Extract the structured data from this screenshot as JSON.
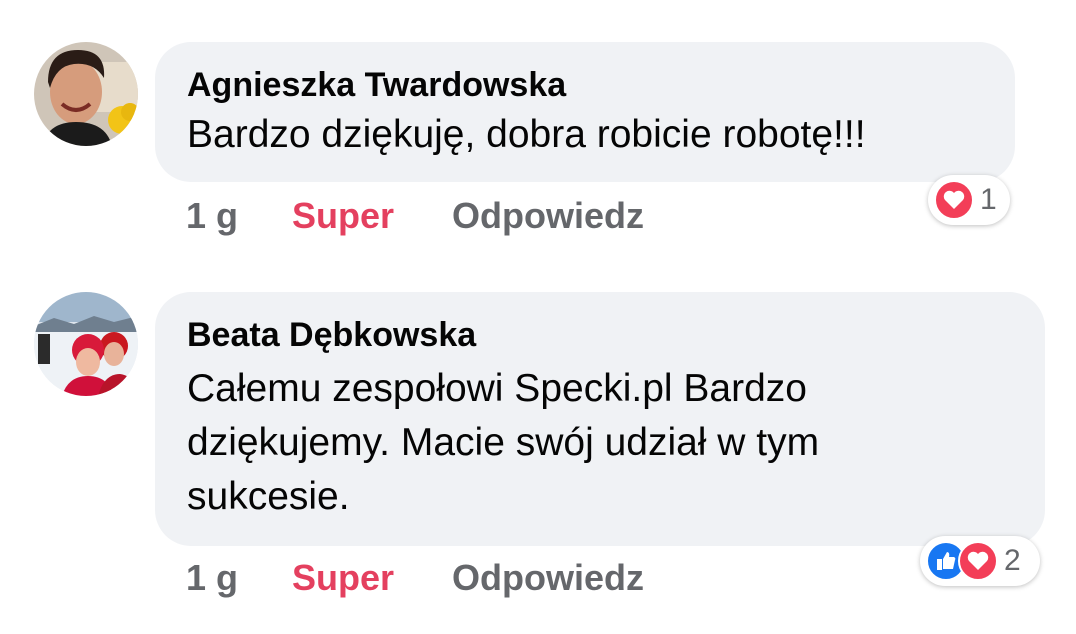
{
  "comments": [
    {
      "author": "Agnieszka Twardowska",
      "text": "Bardzo dziękuję, dobra robicie robotę!!!",
      "time": "1 g",
      "react_label": "Super",
      "reply_label": "Odpowiedz",
      "reactions": [
        "love-icon"
      ],
      "reaction_count": "1"
    },
    {
      "author": "Beata Dębkowska",
      "text_lines": [
        "Całemu zespołowi Specki.pl Bardzo",
        "dziękujemy. Macie swój udział w tym",
        "sukcesie."
      ],
      "time": "1 g",
      "react_label": "Super",
      "reply_label": "Odpowiedz",
      "reactions": [
        "like-icon",
        "love-icon"
      ],
      "reaction_count": "2"
    }
  ],
  "colors": {
    "bubble": "#f0f2f5",
    "react": "#e4405f",
    "meta": "#65676b",
    "like": "#1877f2",
    "love": "#f33e58"
  }
}
